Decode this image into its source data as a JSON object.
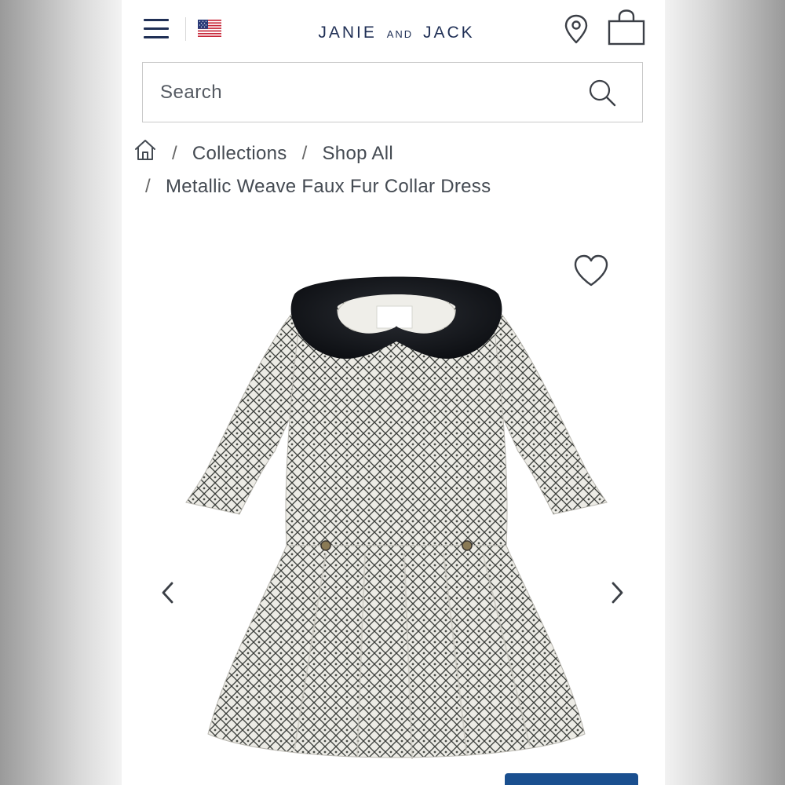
{
  "header": {
    "brand": {
      "part1": "JANIE",
      "part2": "AND",
      "part3": "JACK"
    },
    "menu_icon": "hamburger-menu-icon",
    "flag_icon": "us-flag-icon",
    "store_icon": "location-pin-icon",
    "cart_icon": "shopping-bag-icon"
  },
  "search": {
    "placeholder": "Search",
    "icon": "search-icon"
  },
  "breadcrumb": {
    "home_icon": "home-icon",
    "items": [
      "Collections",
      "Shop All",
      "Metallic Weave Faux Fur Collar Dress"
    ],
    "separator": "/"
  },
  "product": {
    "image_alt": "Metallic Weave Faux Fur Collar Dress",
    "favorite_icon": "heart-outline-icon",
    "prev_icon": "chevron-left-icon",
    "next_icon": "chevron-right-icon"
  },
  "colors": {
    "brand_navy": "#1f2f55",
    "text_gray": "#444a52",
    "border_gray": "#c9c9c9",
    "cta_blue": "#1a4f8f"
  }
}
